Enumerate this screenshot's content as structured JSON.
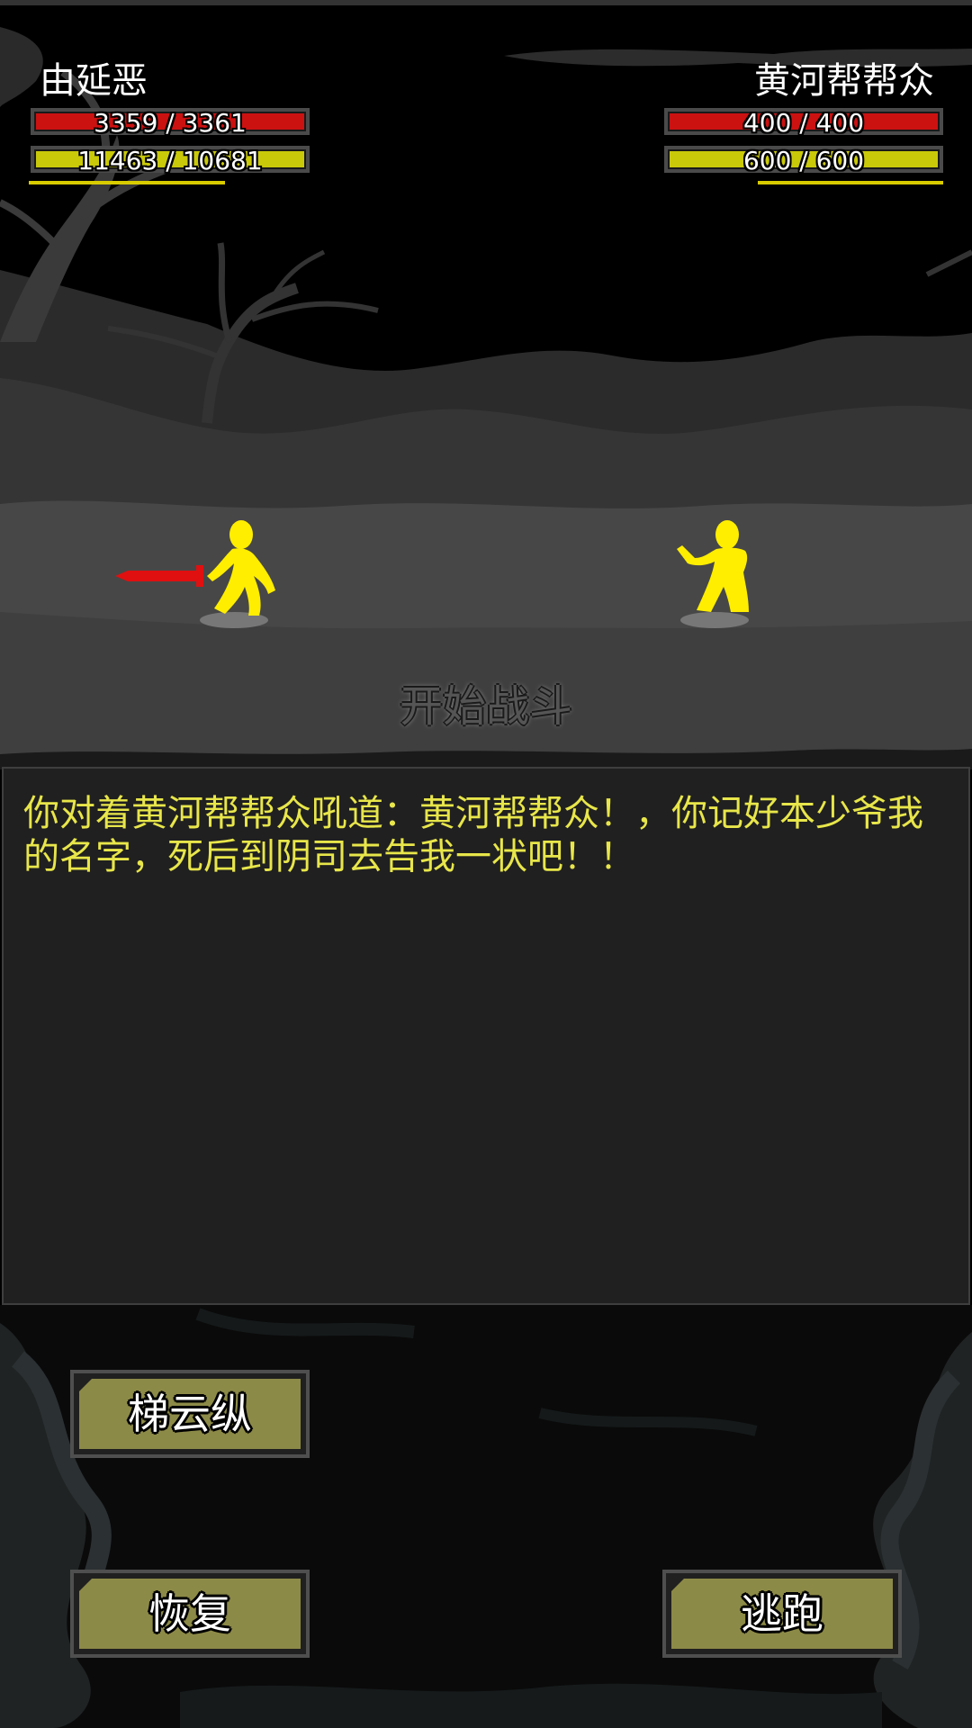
{
  "player": {
    "name": "由延恶",
    "hp_text": "3359 / 3361",
    "hp_current": 3359,
    "hp_max": 3361,
    "mp_text": "11463 / 10681",
    "mp_current": 11463,
    "mp_max": 10681,
    "weapon_color": "#e01010",
    "figure_color": "#ffee00"
  },
  "enemy": {
    "name": "黄河帮帮众",
    "hp_text": "400 / 400",
    "hp_current": 400,
    "hp_max": 400,
    "mp_text": "600 / 600",
    "mp_current": 600,
    "mp_max": 600,
    "figure_color": "#ffee00"
  },
  "battle": {
    "status_text": "开始战斗"
  },
  "log": {
    "lines": [
      "你对着黄河帮帮众吼道：黄河帮帮众！，你记好本少爷我的名字，死后到阴司去告我一状吧！！"
    ]
  },
  "actions": {
    "skill_label": "梯云纵",
    "recover_label": "恢复",
    "flee_label": "逃跑"
  },
  "colors": {
    "hp": "#cc1111",
    "mp": "#c9c90a",
    "button_face": "#8c8a47",
    "log_text": "#e8e64a"
  }
}
